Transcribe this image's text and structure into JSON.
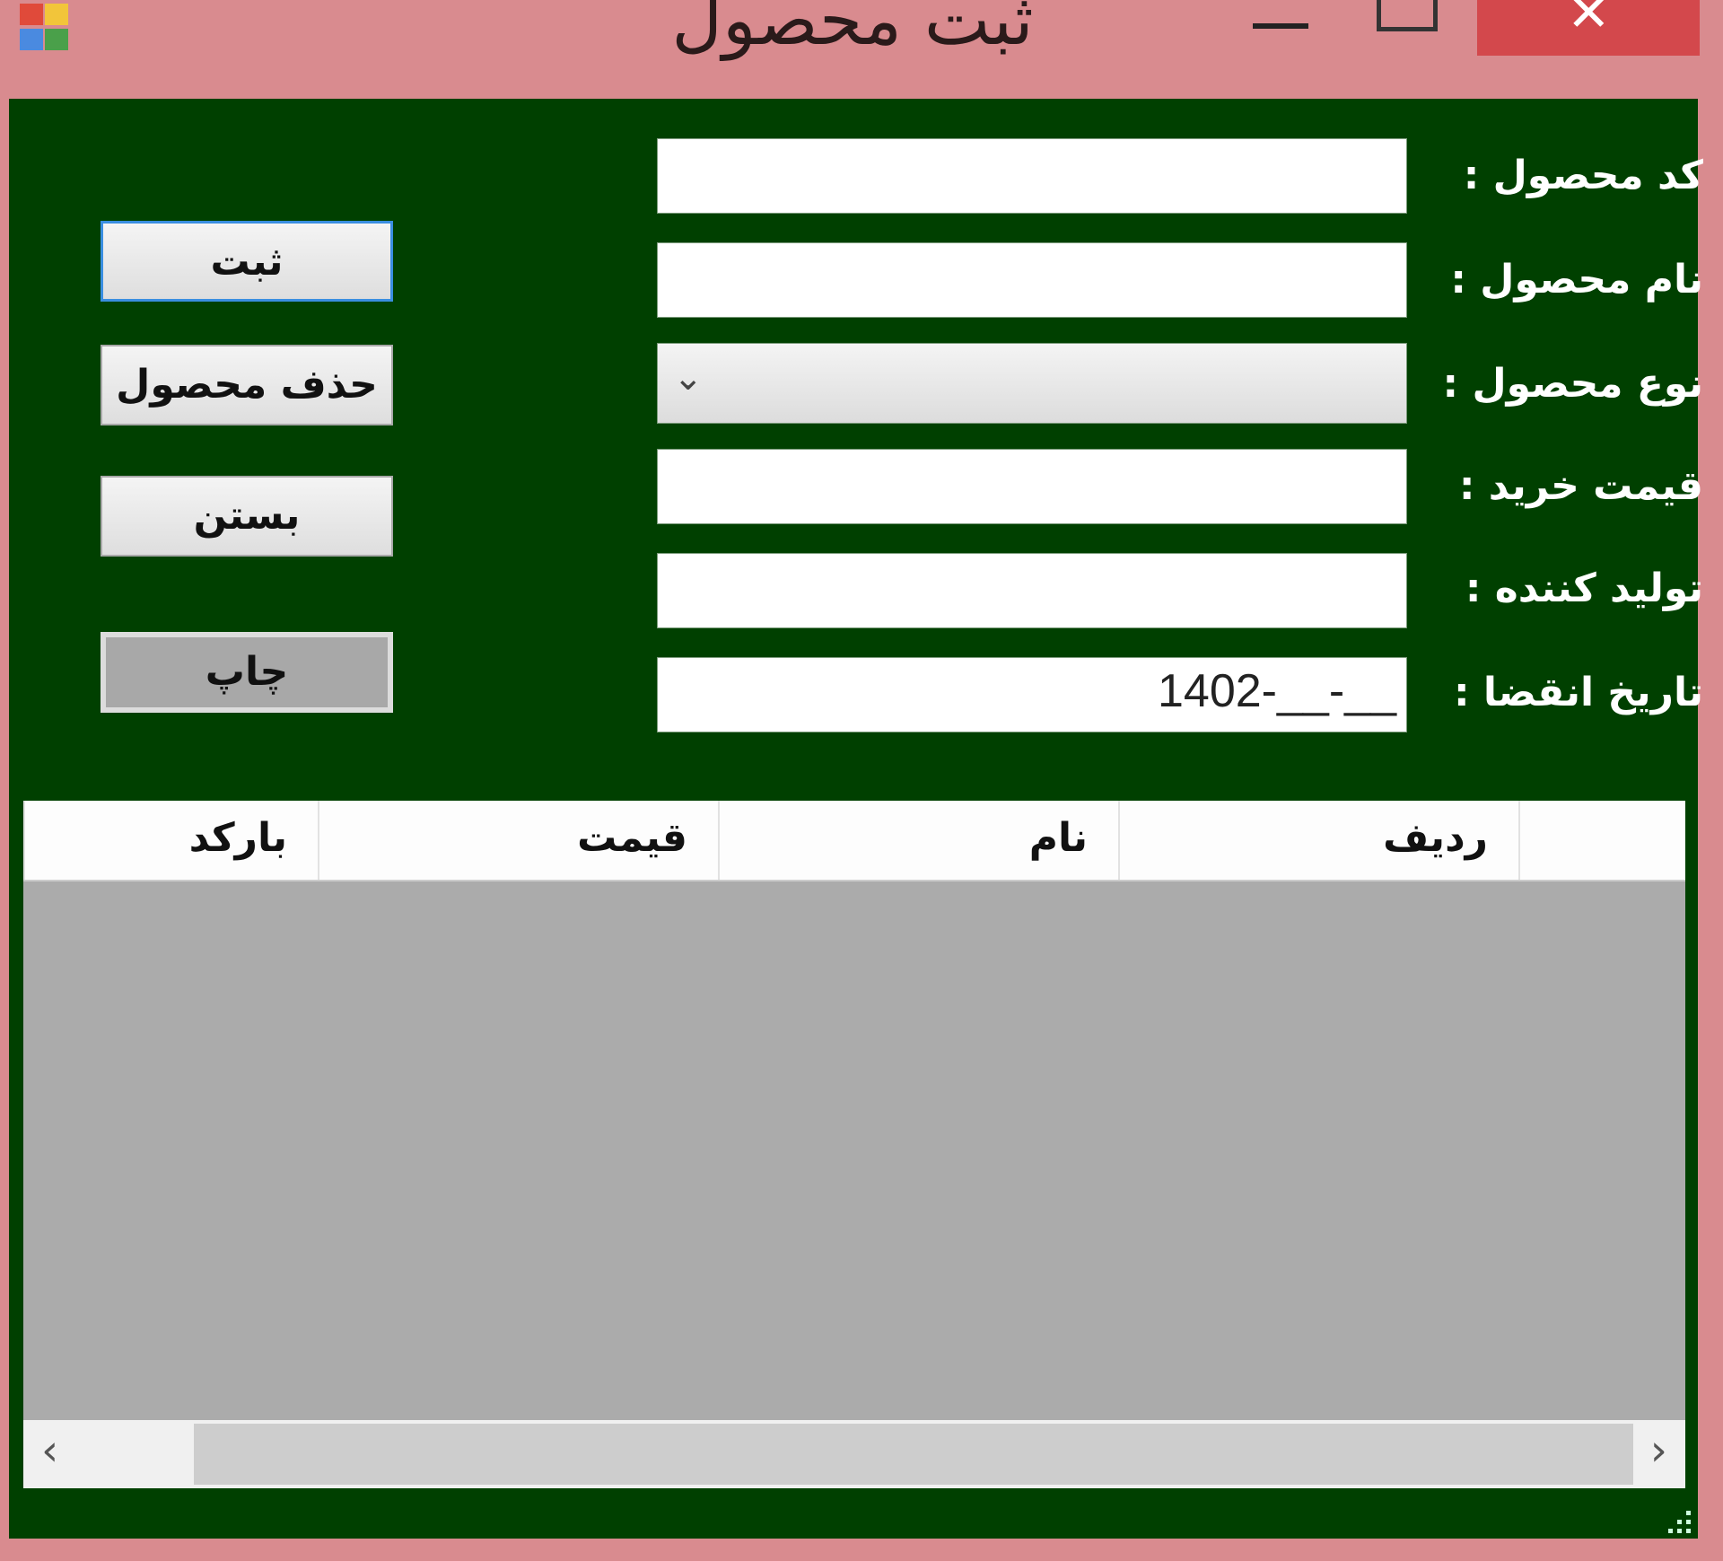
{
  "window": {
    "title": "ثبت محصول",
    "close_glyph": "✕"
  },
  "form": {
    "fields": [
      {
        "label": "کد محصول :",
        "value": ""
      },
      {
        "label": "نام محصول :",
        "value": ""
      },
      {
        "label": "نوع محصول :",
        "value": ""
      },
      {
        "label": "قیمت خرید :",
        "value": ""
      },
      {
        "label": "تولید کننده :",
        "value": ""
      },
      {
        "label": "تاریخ انقضا :",
        "value": "1402-__-__"
      }
    ]
  },
  "buttons": {
    "save": "ثبت",
    "delete": "حذف محصول",
    "close": "بستن",
    "print": "چاپ"
  },
  "grid": {
    "columns": [
      "ردیف",
      "نام",
      "قیمت",
      "بارکد"
    ],
    "rows": []
  },
  "colors": {
    "title_bar": "#d98b8f",
    "client_bg": "#004000",
    "close_button": "#d3484c",
    "grid_bg": "#ababab"
  },
  "icons": {
    "app": "app-window-icon",
    "combo": "chevron-down-icon",
    "scroll_left": "chevron-left-icon",
    "scroll_right": "chevron-right-icon"
  }
}
